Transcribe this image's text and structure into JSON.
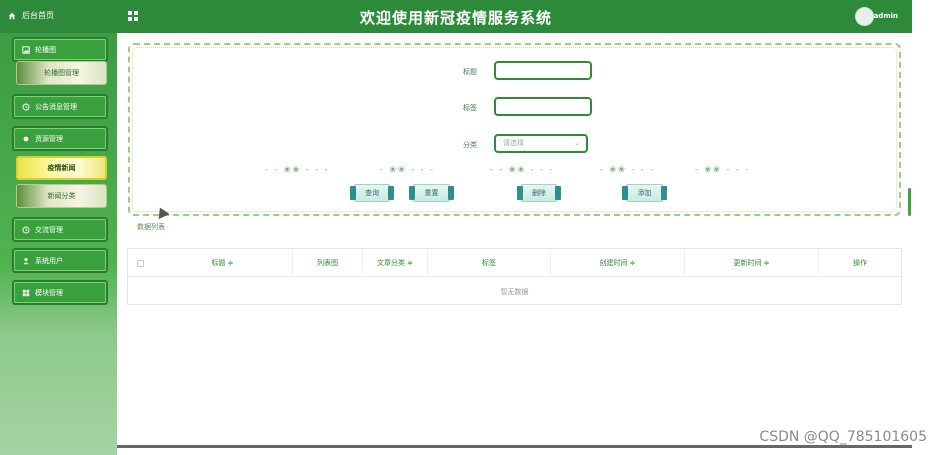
{
  "header": {
    "home_label": "后台首页",
    "title": "欢迎使用新冠疫情服务系统",
    "username": "admin",
    "accent": "#2d8a3a"
  },
  "sidebar": {
    "items": [
      {
        "label": "轮播图",
        "icon": "image-icon"
      },
      {
        "label": "轮播图管理",
        "sub": true
      },
      {
        "label": "公告消息管理",
        "icon": "clock-icon"
      },
      {
        "label": "资源管理",
        "icon": "dot-icon"
      },
      {
        "label": "疫情新闻",
        "sub": true,
        "active": true
      },
      {
        "label": "新闻分类",
        "sub": true
      },
      {
        "label": "交流管理",
        "icon": "clock-icon"
      },
      {
        "label": "系统用户",
        "icon": "user-icon"
      },
      {
        "label": "模块管理",
        "icon": "grid-icon"
      }
    ]
  },
  "search": {
    "title_label": "标题",
    "tag_label": "标签",
    "category_label": "分类",
    "category_placeholder": "请选择",
    "buttons": {
      "query": "查询",
      "reset": "重置",
      "delete": "删除",
      "add": "添加"
    }
  },
  "list": {
    "label": "数据列表",
    "columns": [
      "标题 ≑",
      "列表图",
      "文章分类 ≑",
      "标签",
      "创建时间 ≑",
      "更新时间 ≑",
      "操作"
    ],
    "empty_text": "暂无数据"
  },
  "watermark": "CSDN @QQ_785101605"
}
